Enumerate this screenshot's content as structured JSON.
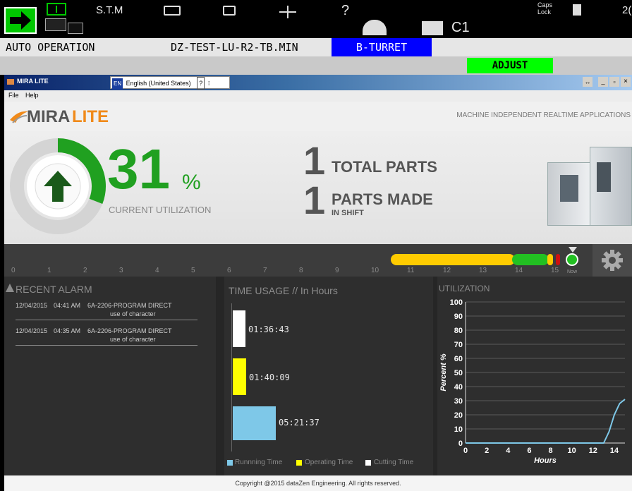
{
  "cnc": {
    "stm": "S.T.M",
    "question": "?",
    "c1": "C1",
    "caps_lock": "Caps\nLock",
    "clock_fragment": "2(",
    "mode": "AUTO OPERATION",
    "program": "DZ-TEST-LU-R2-TB.MIN",
    "turret": "B-TURRET",
    "adjust": "ADJUST",
    "colors": {
      "green": "#00c800",
      "blue": "#0000ff",
      "adjust_bg": "#00ff00"
    }
  },
  "app": {
    "title": "MIRA LITE",
    "language_code": "EN",
    "language": "English (United States)",
    "menu": [
      "File",
      "Help"
    ],
    "window_controls": [
      "↔",
      "_",
      "▫",
      "×"
    ],
    "logo_first": "MIRA",
    "logo_second": "LITE",
    "tagline": "MACHINE INDEPENDENT REALTIME APPLICATIONS",
    "colors": {
      "accent_green": "#20a020",
      "logo_orange": "#f08a1a"
    }
  },
  "hero": {
    "utilization_value": "31",
    "utilization_unit": "%",
    "utilization_label": "CURRENT UTILIZATION",
    "utilization_fraction": 0.31,
    "total_parts_value": "1",
    "total_parts_label": "TOTAL PARTS",
    "parts_made_value": "1",
    "parts_made_label": "PARTS MADE",
    "parts_made_sub": "IN SHIFT"
  },
  "timeline": {
    "ticks": [
      "0",
      "1",
      "2",
      "3",
      "4",
      "5",
      "6",
      "7",
      "8",
      "9",
      "10",
      "11",
      "12",
      "13",
      "14",
      "15"
    ],
    "now_label": "Now",
    "colors": {
      "yellow": "#ffcc00",
      "green": "#22c022",
      "red": "#cc1111"
    }
  },
  "alarms": {
    "title": "RECENT ALARM",
    "items": [
      {
        "date": "12/04/2015",
        "time": "04:41 AM",
        "code": "6A-2206-PROGRAM DIRECT",
        "detail": "use of character"
      },
      {
        "date": "12/04/2015",
        "time": "04:35 AM",
        "code": "6A-2206-PROGRAM DIRECT",
        "detail": "use of character"
      }
    ]
  },
  "time_usage": {
    "title": "TIME USAGE // In Hours",
    "bars": [
      {
        "name": "Cutting Time",
        "value": "01:36:43",
        "hours": 1.612,
        "color": "#ffffff"
      },
      {
        "name": "Operating Time",
        "value": "01:40:09",
        "hours": 1.669,
        "color": "#ffff00"
      },
      {
        "name": "Runnning Time",
        "value": "05:21:37",
        "hours": 5.36,
        "color": "#7ec8e8"
      }
    ],
    "legend": [
      "Runnning Time",
      "Operating Time",
      "Cutting Time"
    ]
  },
  "chart_data": {
    "type": "line",
    "title": "UTILIZATION",
    "xlabel": "Hours",
    "ylabel": "Percent %",
    "x_ticks": [
      0,
      2,
      4,
      6,
      8,
      10,
      12,
      14
    ],
    "y_ticks": [
      0,
      10,
      20,
      30,
      40,
      50,
      60,
      70,
      80,
      90,
      100
    ],
    "xlim": [
      0,
      15
    ],
    "ylim": [
      0,
      100
    ],
    "grid": true,
    "series": [
      {
        "x": [
          0,
          1,
          2,
          3,
          4,
          5,
          6,
          7,
          8,
          9,
          10,
          11,
          12,
          13,
          13.5,
          14,
          14.5,
          15
        ],
        "y": [
          0,
          0,
          0,
          0,
          0,
          0,
          0,
          0,
          0,
          0,
          0,
          0,
          0,
          0,
          8,
          20,
          28,
          31
        ],
        "color": "#7ec8e8"
      }
    ]
  },
  "footer": {
    "copyright": "Copyright @2015 dataZen Engineering. All rights reserved."
  }
}
